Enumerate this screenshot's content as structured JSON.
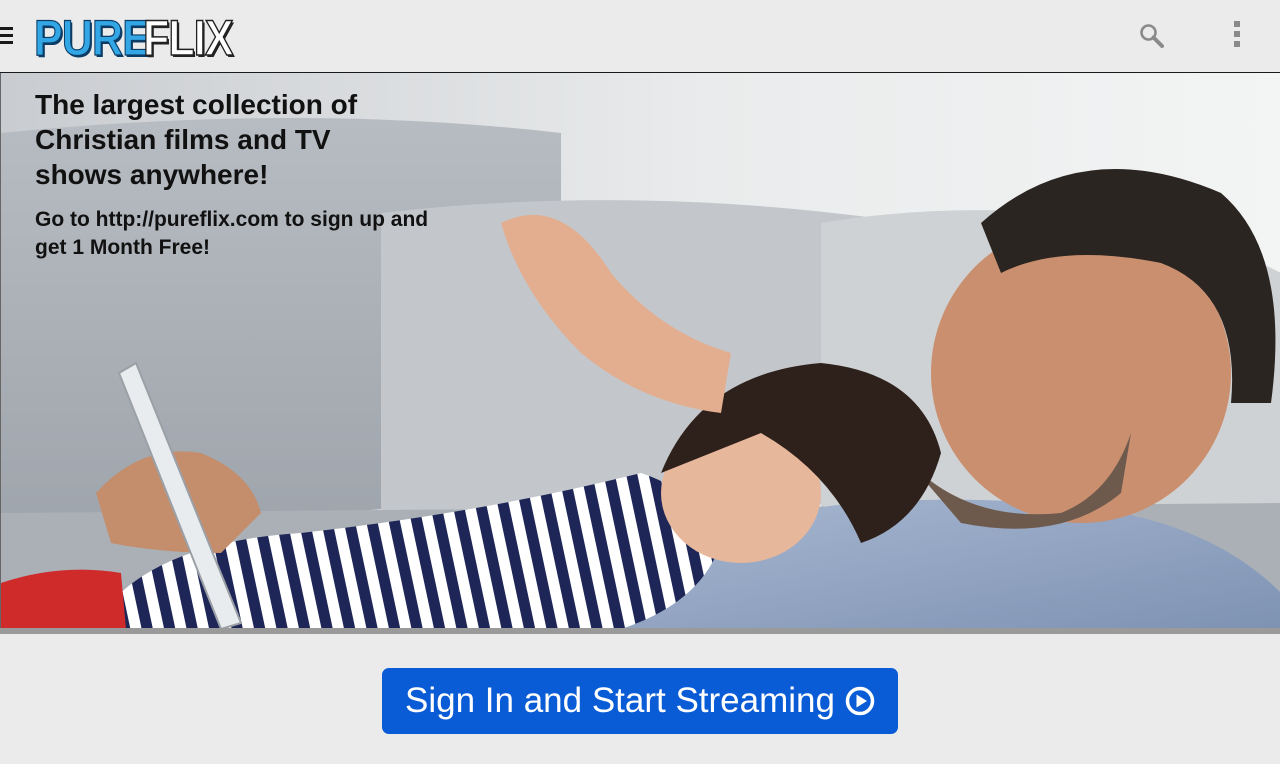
{
  "header": {
    "logo": {
      "word1": "PURE",
      "word2": "FLIX"
    },
    "menu_icon": "hamburger-menu-icon",
    "search_icon": "search-icon",
    "overflow_icon": "more-vert-icon"
  },
  "hero": {
    "headline": "The largest collection of Christian films and TV shows anywhere!",
    "subline": "Go to http://pureflix.com to sign up and get 1 Month Free!",
    "image": "father-and-daughter-on-sofa-with-tablet"
  },
  "cta": {
    "label": "Sign In and Start Streaming",
    "icon": "play-circle-icon"
  },
  "colors": {
    "brand_blue": "#33a6e6",
    "button_blue": "#0a5cd6",
    "background": "#ebebeb"
  }
}
